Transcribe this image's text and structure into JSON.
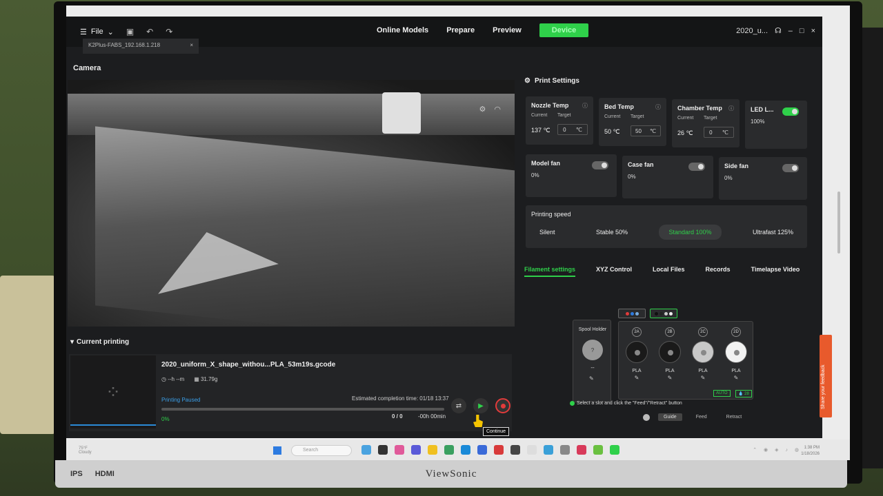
{
  "window": {
    "file_label": "File",
    "device_tab": "K2Plus-FABS_192.168.1.218",
    "device_tab_close": "×",
    "account": "2020_u...",
    "minimize": "–",
    "maximize": "□",
    "close": "×"
  },
  "nav": {
    "online_models": "Online Models",
    "prepare": "Prepare",
    "preview": "Preview",
    "device": "Device"
  },
  "camera": {
    "title": "Camera"
  },
  "current": {
    "title": "Current printing",
    "filename": "2020_uniform_X_shape_withou...PLA_53m19s.gcode",
    "time": "--h --m",
    "weight": "31.79g",
    "status": "Printing Paused",
    "estimated": "Estimated completion time: 01/18 13:37",
    "progress": 0,
    "percent": "0%",
    "layers": "0 / 0",
    "remaining": "-00h 00min",
    "tooltip": "Continue"
  },
  "print_settings": {
    "title": "Print Settings",
    "nozzle": {
      "title": "Nozzle Temp",
      "current_label": "Current",
      "target_label": "Target",
      "current": "137 ℃",
      "target": "0",
      "unit": "℃"
    },
    "bed": {
      "title": "Bed Temp",
      "current_label": "Current",
      "target_label": "Target",
      "current": "50 ℃",
      "target": "50",
      "unit": "℃"
    },
    "chamber": {
      "title": "Chamber Temp",
      "current_label": "Current",
      "target_label": "Target",
      "current": "26 ℃",
      "target": "0",
      "unit": "℃"
    },
    "led": {
      "title": "LED L...",
      "value": "100%"
    },
    "model_fan": {
      "title": "Model fan",
      "value": "0%"
    },
    "case_fan": {
      "title": "Case fan",
      "value": "0%"
    },
    "side_fan": {
      "title": "Side fan",
      "value": "0%"
    },
    "speed": {
      "title": "Printing speed",
      "options": [
        "Silent",
        "Stable 50%",
        "Standard 100%",
        "Ultrafast 125%"
      ],
      "selected": "Standard 100%"
    }
  },
  "tabs": [
    "Filament settings",
    "XYZ Control",
    "Local Files",
    "Records",
    "Timelapse Video"
  ],
  "filament": {
    "spool_holder": "Spool Holder",
    "spool_disc": "?",
    "spool_value": "--",
    "slots": [
      {
        "id": "2A",
        "material": "PLA",
        "color": "#1a1a1a"
      },
      {
        "id": "2B",
        "material": "PLA",
        "color": "#1a1a1a"
      },
      {
        "id": "2C",
        "material": "PLA",
        "color": "#c8c8c8"
      },
      {
        "id": "2D",
        "material": "PLA",
        "color": "#f2f2f2"
      }
    ],
    "auto": "AUTO",
    "humidity": "28",
    "hint": "Select a slot and click the \"Feed\"/\"Retract\" button",
    "guide": "Guide",
    "feed": "Feed",
    "retract": "Retract"
  },
  "feedback": "Share your feedback",
  "taskbar": {
    "weather_temp": "75°F",
    "weather_desc": "Cloudy",
    "search": "Search",
    "time": "1:38 PM",
    "date": "1/18/2026"
  },
  "bezel": {
    "brand": "ViewSonic",
    "ips": "IPS",
    "hdmi": "HDMI"
  },
  "colors": {
    "accent": "#2fd04a",
    "status": "#3b9fe8",
    "stop": "#e23b3b"
  }
}
